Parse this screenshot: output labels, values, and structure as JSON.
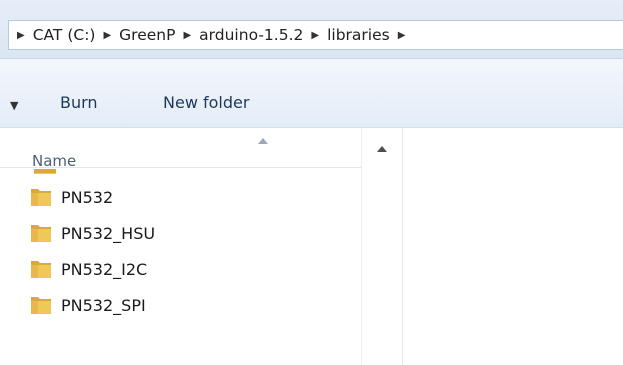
{
  "breadcrumb": {
    "items": [
      {
        "label": "CAT (C:)"
      },
      {
        "label": "GreenP"
      },
      {
        "label": "arduino-1.5.2"
      },
      {
        "label": "libraries"
      },
      {
        "label": ""
      }
    ]
  },
  "toolbar": {
    "burn_label": "Burn",
    "new_folder_label": "New folder",
    "dropdown_icon": "chevron-down-icon"
  },
  "file_list": {
    "column_name": "Name",
    "sort_indicator": "sort-ascending-icon",
    "items": [
      {
        "name": "PN532"
      },
      {
        "name": "PN532_HSU"
      },
      {
        "name": "PN532_I2C"
      },
      {
        "name": "PN532_SPI"
      }
    ]
  },
  "colors": {
    "folder_fill": "#f0c85a",
    "folder_shade": "#d9a93a",
    "toolbar_text": "#1e395b",
    "header_text": "#4c607a"
  }
}
